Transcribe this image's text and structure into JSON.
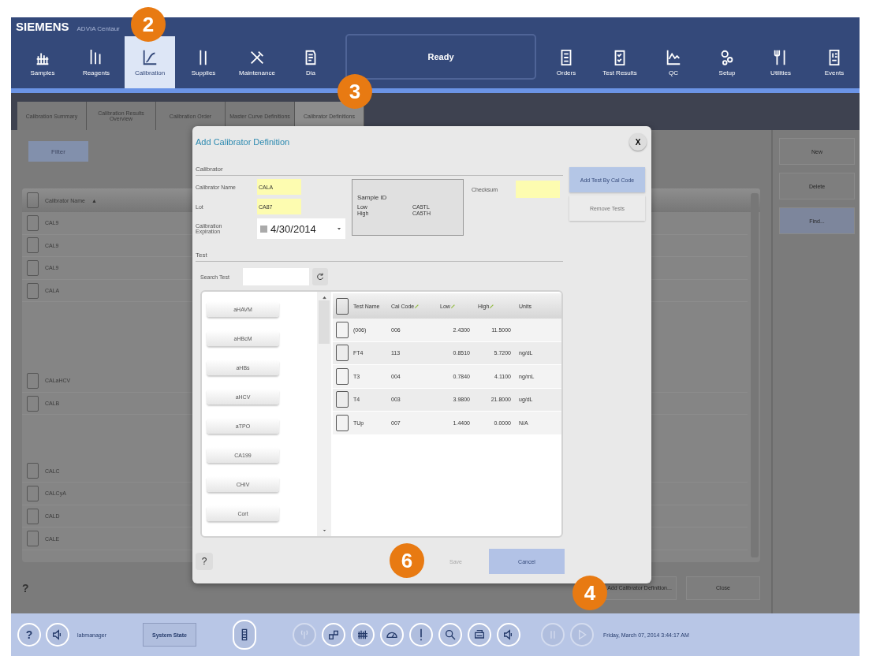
{
  "header": {
    "brand": "SIEMENS",
    "product": "ADVIA Centaur",
    "status": "Ready",
    "nav_left": [
      {
        "label": "Samples",
        "selected": false
      },
      {
        "label": "Reagents",
        "selected": false
      },
      {
        "label": "Calibration",
        "selected": true
      },
      {
        "label": "Supplies",
        "selected": false
      },
      {
        "label": "Maintenance",
        "selected": false
      },
      {
        "label": "Dia",
        "selected": false
      }
    ],
    "nav_right": [
      {
        "label": "Orders",
        "selected": false
      },
      {
        "label": "Test Results",
        "selected": false
      },
      {
        "label": "QC",
        "selected": false
      },
      {
        "label": "Setup",
        "selected": false
      },
      {
        "label": "Utilities",
        "selected": false
      },
      {
        "label": "Events",
        "selected": false
      }
    ]
  },
  "subtabs": [
    {
      "label": "Calibration Summary",
      "selected": false
    },
    {
      "label": "Calibration Results Overview",
      "selected": false
    },
    {
      "label": "Calibration Order",
      "selected": false
    },
    {
      "label": "Master Curve Definitions",
      "selected": false
    },
    {
      "label": "Calibrator Definitions",
      "selected": true
    }
  ],
  "calibrator_list": {
    "filter_button": "Filter",
    "header_checked": false,
    "header": "Calibrator Name",
    "sort": "▲",
    "rows": [
      {
        "kind": "entry",
        "name": "CAL9",
        "checked": false
      },
      {
        "kind": "entry",
        "name": "CAL9",
        "checked": false
      },
      {
        "kind": "entry",
        "name": "CAL9",
        "checked": false
      },
      {
        "kind": "entry",
        "name": "CALA",
        "checked": false
      },
      {
        "kind": "blank"
      },
      {
        "kind": "blank"
      },
      {
        "kind": "blank"
      },
      {
        "kind": "entry",
        "name": "CALaHCV",
        "checked": false
      },
      {
        "kind": "entry",
        "name": "CALB",
        "checked": false
      },
      {
        "kind": "blank"
      },
      {
        "kind": "blank"
      },
      {
        "kind": "entry",
        "name": "CALC",
        "checked": false
      },
      {
        "kind": "entry",
        "name": "CALCyA",
        "checked": false
      },
      {
        "kind": "entry",
        "name": "CALD",
        "checked": false
      },
      {
        "kind": "entry",
        "name": "CALE",
        "checked": false
      }
    ]
  },
  "side_buttons": [
    {
      "label": "New",
      "highlighted": false
    },
    {
      "label": "Delete",
      "highlighted": false
    },
    {
      "label": "Find...",
      "highlighted": true
    }
  ],
  "help": "?",
  "footer_buttons": [
    {
      "label": "Add Calibrator Definition...",
      "highlighted": false
    },
    {
      "label": "Close",
      "highlighted": false
    }
  ],
  "dialog": {
    "title": "Add Calibrator Definition",
    "close": "X",
    "calibrator_section": "Calibrator",
    "name_label": "Calibrator Name",
    "name_value": "CALA",
    "lot_label": "Lot",
    "lot_value": "CA87",
    "expiration_label": "Calibration Expiration",
    "expiration_checked": true,
    "expiration_value": "4/30/2014",
    "sample_id": {
      "title": "Sample ID",
      "rows": [
        {
          "label": "Low",
          "value": "CA5TL"
        },
        {
          "label": "High",
          "value": "CA5TH"
        }
      ]
    },
    "checksum_label": "Checksum",
    "test_section": "Test",
    "search_label": "Search Test",
    "test_buttons": [
      "aHAVM",
      "aHBcM",
      "aHBs",
      "aHCV",
      "aTPO",
      "CA199",
      "CHIV",
      "Cort"
    ],
    "all_checked": false,
    "columns": [
      {
        "label": "Test Name",
        "editable": false
      },
      {
        "label": "Cal Code",
        "editable": true
      },
      {
        "label": "Low",
        "editable": true
      },
      {
        "label": "High",
        "editable": true
      },
      {
        "label": "Units",
        "editable": false
      }
    ],
    "rows": [
      {
        "checked": false,
        "cells": [
          "(006)",
          "006",
          "2.4300",
          "11.5000"
        ]
      },
      {
        "checked": false,
        "cells": [
          "FT4",
          "113",
          "0.8510",
          "5.7200",
          "ng/dL"
        ]
      },
      {
        "checked": false,
        "cells": [
          "T3",
          "004",
          "0.7840",
          "4.1100",
          "ng/mL"
        ]
      },
      {
        "checked": false,
        "cells": [
          "T4",
          "003",
          "3.9800",
          "21.8000",
          "ug/dL"
        ]
      },
      {
        "checked": false,
        "cells": [
          "TUp",
          "007",
          "1.4400",
          "0.0000",
          "N/A"
        ]
      }
    ],
    "side_actions": [
      {
        "label": "Add Test By Cal Code",
        "primary": true
      },
      {
        "label": "Remove Tests",
        "primary": false
      }
    ],
    "help": "?",
    "actions": [
      {
        "label": "Save",
        "disabled": true,
        "primary": false
      },
      {
        "label": "Cancel",
        "disabled": false,
        "primary": true
      }
    ]
  },
  "status_bar": {
    "help": "?",
    "user": "labmanager",
    "system_state": "System State",
    "tools": [
      {
        "disabled": true
      },
      {
        "disabled": false
      },
      {
        "disabled": false
      },
      {
        "disabled": false
      },
      {
        "disabled": false
      },
      {
        "disabled": false
      },
      {
        "disabled": false
      },
      {
        "disabled": false
      }
    ],
    "transport": [
      {
        "disabled": true
      },
      {
        "disabled": true
      }
    ],
    "datetime": "Friday, March 07, 2014 3:44:17 AM"
  },
  "callouts": [
    "2",
    "3",
    "4",
    "6"
  ]
}
